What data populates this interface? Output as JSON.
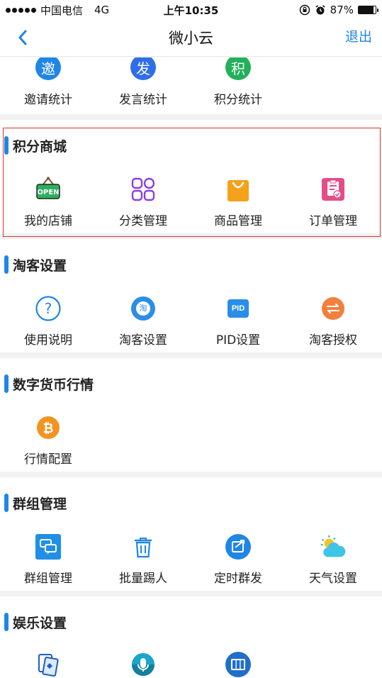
{
  "status": {
    "carrier": "中国电信",
    "network": "4G",
    "time": "上午10:35",
    "battery": "87%",
    "battery_level": 0.87
  },
  "nav": {
    "title": "微小云",
    "exit_label": "退出"
  },
  "stats": {
    "items": [
      {
        "glyph": "邀",
        "label": "邀请统计",
        "color": "#1f86e6"
      },
      {
        "glyph": "发",
        "label": "发言统计",
        "color": "#2f6ee8"
      },
      {
        "glyph": "积",
        "label": "积分统计",
        "color": "#22b05a"
      }
    ]
  },
  "mall": {
    "title": "积分商城",
    "items": [
      {
        "label": "我的店铺",
        "icon": "open-sign-icon"
      },
      {
        "label": "分类管理",
        "icon": "category-grid-icon"
      },
      {
        "label": "商品管理",
        "icon": "shopping-bag-icon"
      },
      {
        "label": "订单管理",
        "icon": "clipboard-check-icon"
      }
    ]
  },
  "taoke": {
    "title": "淘客设置",
    "items": [
      {
        "label": "使用说明",
        "icon": "help-icon"
      },
      {
        "label": "淘客设置",
        "icon": "taobao-icon",
        "glyph": "淘"
      },
      {
        "label": "PID设置",
        "icon": "pid-icon",
        "glyph": "PID"
      },
      {
        "label": "淘客授权",
        "icon": "transfer-icon"
      }
    ]
  },
  "crypto": {
    "title": "数字货币行情",
    "items": [
      {
        "label": "行情配置",
        "icon": "bitcoin-icon"
      }
    ]
  },
  "group": {
    "title": "群组管理",
    "items": [
      {
        "label": "群组管理",
        "icon": "chat-bubbles-icon"
      },
      {
        "label": "批量踢人",
        "icon": "trash-icon"
      },
      {
        "label": "定时群发",
        "icon": "scheduled-send-icon"
      },
      {
        "label": "天气设置",
        "icon": "weather-icon"
      }
    ]
  },
  "fun": {
    "title": "娱乐设置",
    "items": [
      {
        "icon": "cards-icon"
      },
      {
        "icon": "microphone-icon"
      },
      {
        "icon": "slots-icon"
      }
    ]
  }
}
